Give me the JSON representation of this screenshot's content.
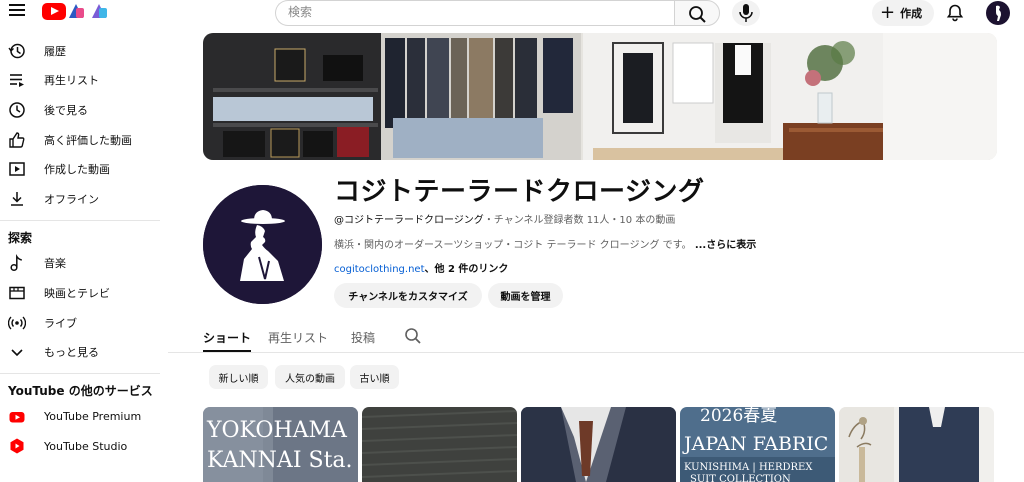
{
  "header": {
    "menu_icon": "hamburger-icon",
    "logo_icon": "youtube-logo-icon",
    "search_placeholder": "検索",
    "create_label": "作成"
  },
  "sidebar": {
    "items_you": [
      {
        "label": "履歴",
        "icon": "history-icon"
      },
      {
        "label": "再生リスト",
        "icon": "playlist-icon"
      },
      {
        "label": "後で見る",
        "icon": "watch-later-icon"
      },
      {
        "label": "高く評価した動画",
        "icon": "thumbs-up-icon"
      },
      {
        "label": "作成した動画",
        "icon": "your-videos-icon"
      },
      {
        "label": "オフライン",
        "icon": "download-icon"
      }
    ],
    "explore_heading": "探索",
    "items_explore": [
      {
        "label": "音楽",
        "icon": "music-icon"
      },
      {
        "label": "映画とテレビ",
        "icon": "movies-icon"
      },
      {
        "label": "ライブ",
        "icon": "live-icon"
      },
      {
        "label": "もっと見る",
        "icon": "chevron-down-icon"
      }
    ],
    "more_heading": "YouTube の他のサービス",
    "items_more": [
      {
        "label": "YouTube Premium",
        "icon": "youtube-premium-icon"
      },
      {
        "label": "YouTube Studio",
        "icon": "youtube-studio-icon"
      }
    ]
  },
  "channel": {
    "name": "コジトテーラードクロージング",
    "handle": "@コジトテーラードクロージング",
    "meta": "・チャンネル登録者数 11人・10 本の動画",
    "description": "横浜・関内のオーダースーツショップ・コジト テーラード クロージング です。",
    "more_label": "...さらに表示",
    "link": "cogitoclothing.net",
    "other_links": "、他 2 件のリンク",
    "customize_label": "チャンネルをカスタマイズ",
    "manage_label": "動画を管理"
  },
  "tabs": [
    "ショート",
    "再生リスト",
    "投稿"
  ],
  "chips": [
    "新しい順",
    "人気の動画",
    "古い順"
  ],
  "shorts": [
    {
      "line1": "YOKOHAMA",
      "line2": "KANNAI Sta."
    },
    {
      "line1": "",
      "line2": ""
    },
    {
      "line1": "",
      "line2": ""
    },
    {
      "line1": "2026春夏",
      "line2": "JAPAN FABRIC",
      "line3": "KUNISHIMA | HERDREX",
      "line4": "SUIT COLLECTION"
    },
    {
      "line1": "",
      "line2": ""
    }
  ],
  "colors": {
    "brand_red": "#ff0000",
    "link_blue": "#065fd4",
    "avatar_bg": "#1e1638"
  }
}
